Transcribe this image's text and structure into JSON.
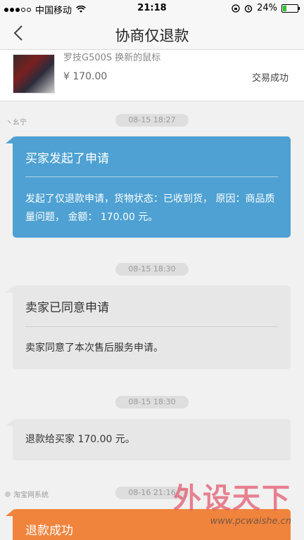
{
  "status_bar": {
    "carrier": "中国移动",
    "time": "21:18",
    "battery": "24%",
    "battery_level": 0.24
  },
  "nav": {
    "title": "协商仅退款",
    "back_icon": "chevron-left-icon"
  },
  "product": {
    "name": "罗技G500S 换新的鼠标",
    "price": "¥ 170.00",
    "status": "交易成功"
  },
  "timeline": [
    {
      "sender": "ヽ幺宁",
      "time": "08-15 18:27",
      "style": "blue",
      "title": "买家发起了申请",
      "text": "发起了仅退款申请，货物状态：已收到货， 原因：商品质量问题， 金额： 170.00 元。"
    },
    {
      "time": "08-15 18:30",
      "style": "gray",
      "title": "卖家已同意申请",
      "text": "卖家同意了本次售后服务申请。"
    },
    {
      "time": "08-15 18:30",
      "style": "gray",
      "text": "退款给买家 170.00 元。"
    },
    {
      "sender": "淘宝网系统",
      "time": "08-16 21:16",
      "style": "orange",
      "title": "退款成功"
    }
  ],
  "watermark": {
    "main": "外设天下",
    "url": "www.pcwaishe.cn"
  },
  "colors": {
    "blue_bubble": "#4ea1d2",
    "gray_bubble": "#e7e7e7",
    "orange_bubble": "#f0843c"
  }
}
